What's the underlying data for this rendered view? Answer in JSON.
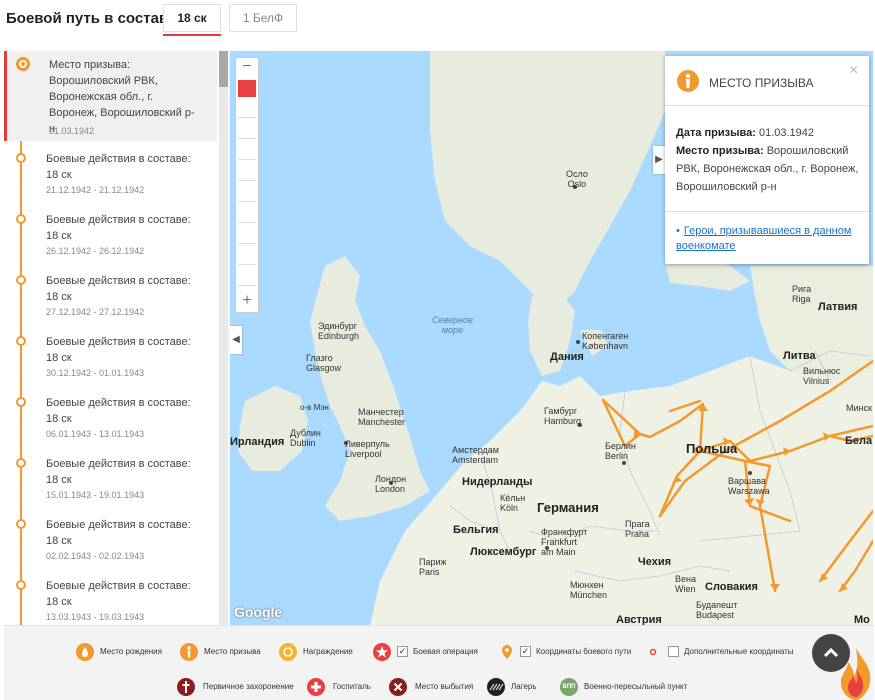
{
  "header": {
    "title": "Боевой путь в составе:",
    "tabs": [
      {
        "label": "18 ск",
        "active": true
      },
      {
        "label": "1 БелФ",
        "active": false
      }
    ]
  },
  "timeline": {
    "items": [
      {
        "title": "Место призыва: Ворошиловский РВК, Воронежская обл., г. Воронеж, Ворошиловский р-н",
        "date": "01.03.1942",
        "selected": true
      },
      {
        "title": "Боевые действия в составе: 18 ск",
        "date": "21.12.1942 - 21.12.1942"
      },
      {
        "title": "Боевые действия в составе: 18 ск",
        "date": "26.12.1942 - 26.12.1942"
      },
      {
        "title": "Боевые действия в составе: 18 ск",
        "date": "27.12.1942 - 27.12.1942"
      },
      {
        "title": "Боевые действия в составе: 18 ск",
        "date": "30.12.1942 - 01.01.1943"
      },
      {
        "title": "Боевые действия в составе: 18 ск",
        "date": "06.01.1943 - 13.01.1943"
      },
      {
        "title": "Боевые действия в составе: 18 ск",
        "date": "15.01.1943 - 19.01.1943"
      },
      {
        "title": "Боевые действия в составе: 18 ск",
        "date": "02.02.1943 - 02.02.1943"
      },
      {
        "title": "Боевые действия в составе: 18 ск",
        "date": "13.03.1943 - 19.03.1943"
      }
    ]
  },
  "map": {
    "zoom_in": "+",
    "zoom_out": "−",
    "attribution": "Google",
    "labels": {
      "oslo": "Осло\nOslo",
      "north_sea": "Северное\nморе",
      "edinburgh": "Эдинбург\nEdinburgh",
      "glasgow": "Глазго\nGlasgow",
      "isle_of_man": "о-в Мэн",
      "manchester": "Манчестер\nManchester",
      "dublin": "Дублин\nDublin",
      "ireland": "Ирландия",
      "liverpool": "Ливерпуль\nLiverpool",
      "london": "Лондон\nLondon",
      "copenhagen": "Копенгаген\nKøbenhavn",
      "denmark": "Дания",
      "hamburg": "Гамбург\nHamburg",
      "amsterdam": "Амстердам\nAmsterdam",
      "netherlands": "Нидерланды",
      "berlin": "Берлин\nBerlin",
      "poland": "Польша",
      "warsaw": "Варшава\nWarszawa",
      "germany": "Германия",
      "cologne": "Кёльн\nKöln",
      "belgium": "Бельгия",
      "luxembourg": "Люксембург",
      "frankfurt": "Франкфурт\nFrankfurt\nam Main",
      "prague": "Прага\nPraha",
      "czechia": "Чехия",
      "paris": "Париж\nParis",
      "munich": "Мюнхен\nMünchen",
      "vienna": "Вена\nWien",
      "slovakia": "Словакия",
      "budapest": "Будапешт\nBudapest",
      "austria": "Австрия",
      "riga": "Рига\nRiga",
      "latvia": "Латвия",
      "lithuania": "Литва",
      "vilnius": "Вильнюс\nVilnius",
      "minsk": "Минск",
      "belarus": "Бела",
      "prague_dot": "",
      "mo": "Мо"
    }
  },
  "popup": {
    "title": "МЕСТО ПРИЗЫВА",
    "close": "×",
    "date_label": "Дата призыва:",
    "date_value": "01.03.1942",
    "place_label": "Место призыва:",
    "place_value": "Ворошиловский РВК, Воронежская обл., г. Воронеж, Ворошиловский р-н",
    "link": "Герои, призывавшиеся в данном военкомате"
  },
  "legend": {
    "items": [
      {
        "label": "Место рождения",
        "color": "#f29a2e"
      },
      {
        "label": "Место призыва",
        "color": "#f29a2e"
      },
      {
        "label": "Награждение",
        "color": "#f29a2e"
      },
      {
        "label": "Боевая операция",
        "color": "#e84141"
      },
      {
        "label": "Координаты боевого пути",
        "color": "#f29a2e"
      },
      {
        "label": "Дополнительные координаты",
        "color": "#e84141"
      },
      {
        "label": "Первичное захоронение",
        "color": "#8b1d1d"
      },
      {
        "label": "Госпиталь",
        "color": "#e84141"
      },
      {
        "label": "Место выбытия",
        "color": "#8b1d1d"
      },
      {
        "label": "Лагерь",
        "color": "#333333"
      },
      {
        "label": "Военно-пересыльный пункт",
        "color": "#7aa56b"
      }
    ],
    "icon_text_camp": "ЛАГ",
    "icon_text_vpp": "ВПП"
  }
}
